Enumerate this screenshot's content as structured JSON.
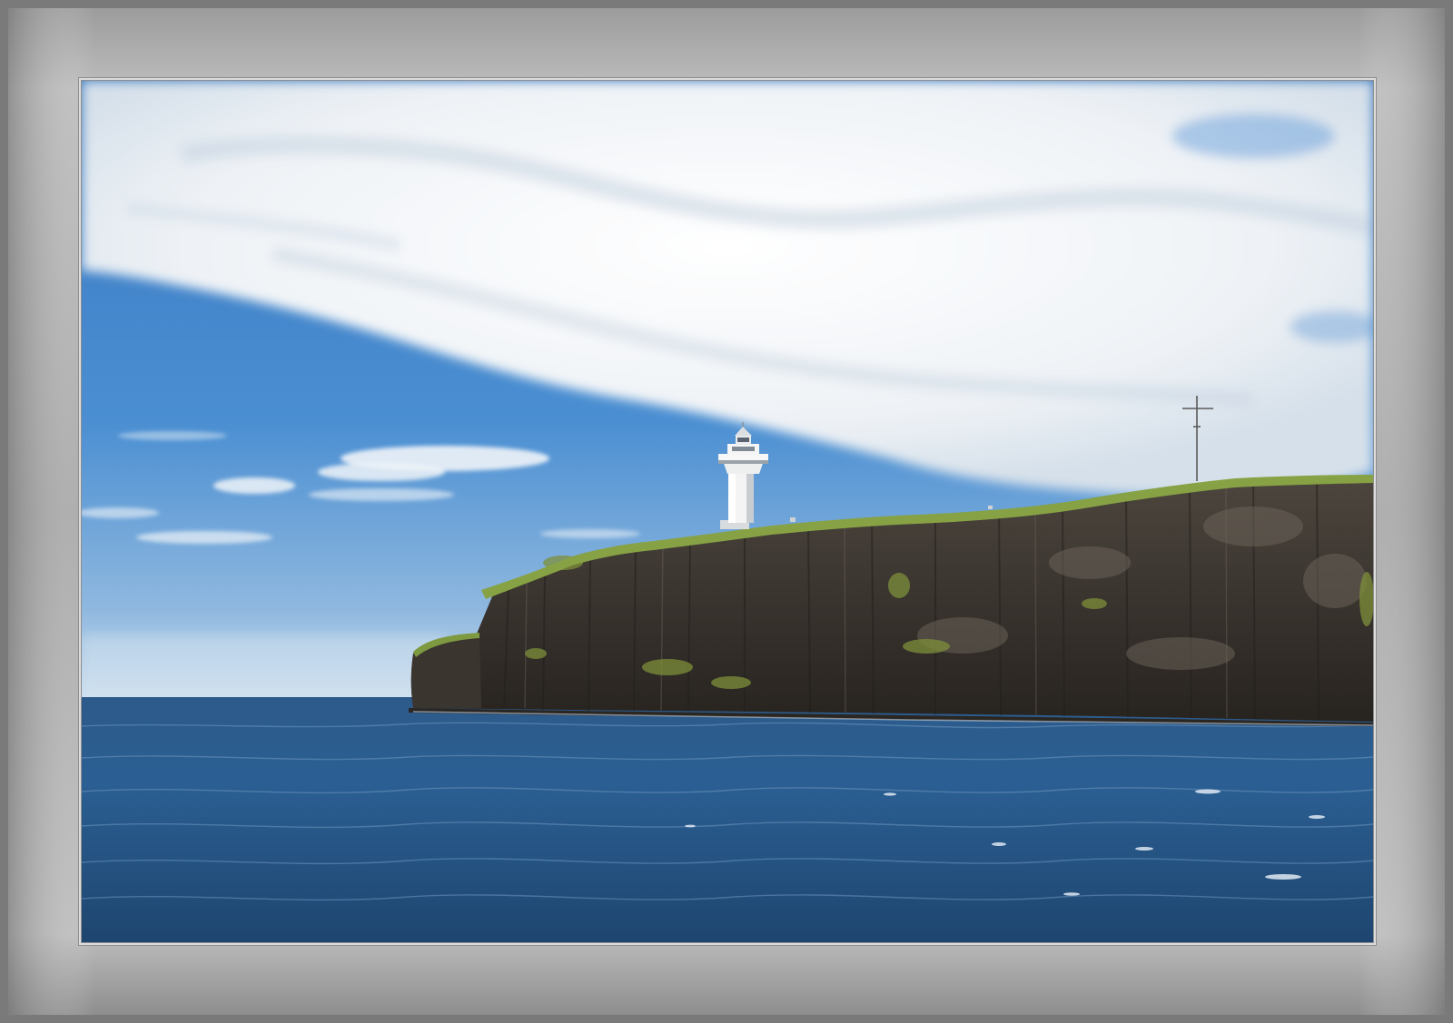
{
  "scene": {
    "subject": "lighthouse-on-cliff",
    "colors": {
      "frame_outer": "#6e6e6e",
      "frame_mid": "#b4b4b4",
      "frame_inner": "#9a9a9a",
      "border_line": "#d8d8d8",
      "sky_top": "#3f7fc6",
      "sky_horizon": "#cfe0ee",
      "cloud": "#f2f4f7",
      "cloud_shadow": "#c9d4e0",
      "sea_far": "#2f5d8e",
      "sea_near": "#1f4670",
      "cliff_dark": "#2e2a27",
      "cliff_mid": "#4a433c",
      "moss": "#7c8d3a",
      "grass": "#8aa246",
      "lighthouse": "#f4f5f4",
      "lighthouse_shadow": "#c8ccd0"
    }
  }
}
